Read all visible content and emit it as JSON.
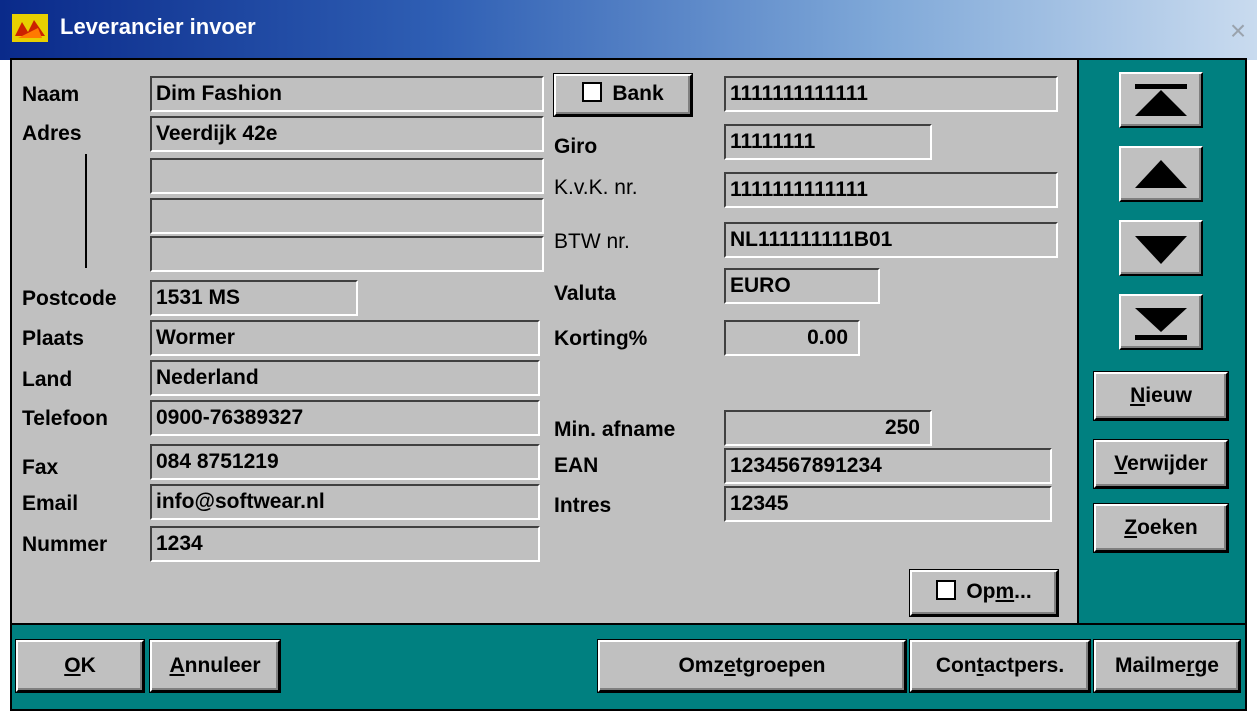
{
  "window": {
    "title": "Leverancier invoer",
    "close_glyph": "×"
  },
  "labels": {
    "naam": "Naam",
    "adres": "Adres",
    "postcode": "Postcode",
    "plaats": "Plaats",
    "land": "Land",
    "telefoon": "Telefoon",
    "fax": "Fax",
    "email": "Email",
    "nummer": "Nummer",
    "giro": "Giro",
    "kvk": "K.v.K. nr.",
    "btw": "BTW nr.",
    "valuta": "Valuta",
    "korting": "Korting%",
    "min_afname": "Min. afname",
    "ean": "EAN",
    "intres": "Intres"
  },
  "fields": {
    "naam": "Dim Fashion",
    "adres1": "Veerdijk 42e",
    "adres2": "",
    "adres3": "",
    "adres4": "",
    "postcode": "1531 MS",
    "plaats": "Wormer",
    "land": "Nederland",
    "telefoon": "0900-76389327",
    "fax": "084 8751219",
    "email": "info@softwear.nl",
    "nummer": "1234",
    "bank": "1111111111111",
    "giro": "11111111",
    "kvk": "1111111111111",
    "btw": "NL111111111B01",
    "valuta": "EURO",
    "korting": "0.00",
    "min_afname": "250",
    "ean": "1234567891234",
    "intres": "12345"
  },
  "buttons": {
    "bank": "Bank",
    "opm": {
      "pre": "Op",
      "u": "m",
      "post": "..."
    },
    "nieuw": {
      "u": "N",
      "post": "ieuw"
    },
    "verwijder": {
      "u": "V",
      "post": "erwijder"
    },
    "zoeken": {
      "u": "Z",
      "post": "oeken"
    },
    "ok": {
      "u": "O",
      "post": "K"
    },
    "annuleer": {
      "u": "A",
      "post": "nnuleer"
    },
    "omzetgroepen": {
      "pre": "Omz",
      "u": "e",
      "post": "tgroepen"
    },
    "contactpers": {
      "pre": "Con",
      "u": "t",
      "post": "actpers."
    },
    "mailmerge": {
      "pre": "Mailme",
      "u": "r",
      "post": "ge"
    }
  },
  "nav_icons": [
    "first-record-icon",
    "previous-record-icon",
    "next-record-icon",
    "last-record-icon"
  ],
  "colors": {
    "panel_teal": "#008080",
    "form_gray": "#c0c0c0",
    "title_blue": "#0a2a8a"
  }
}
